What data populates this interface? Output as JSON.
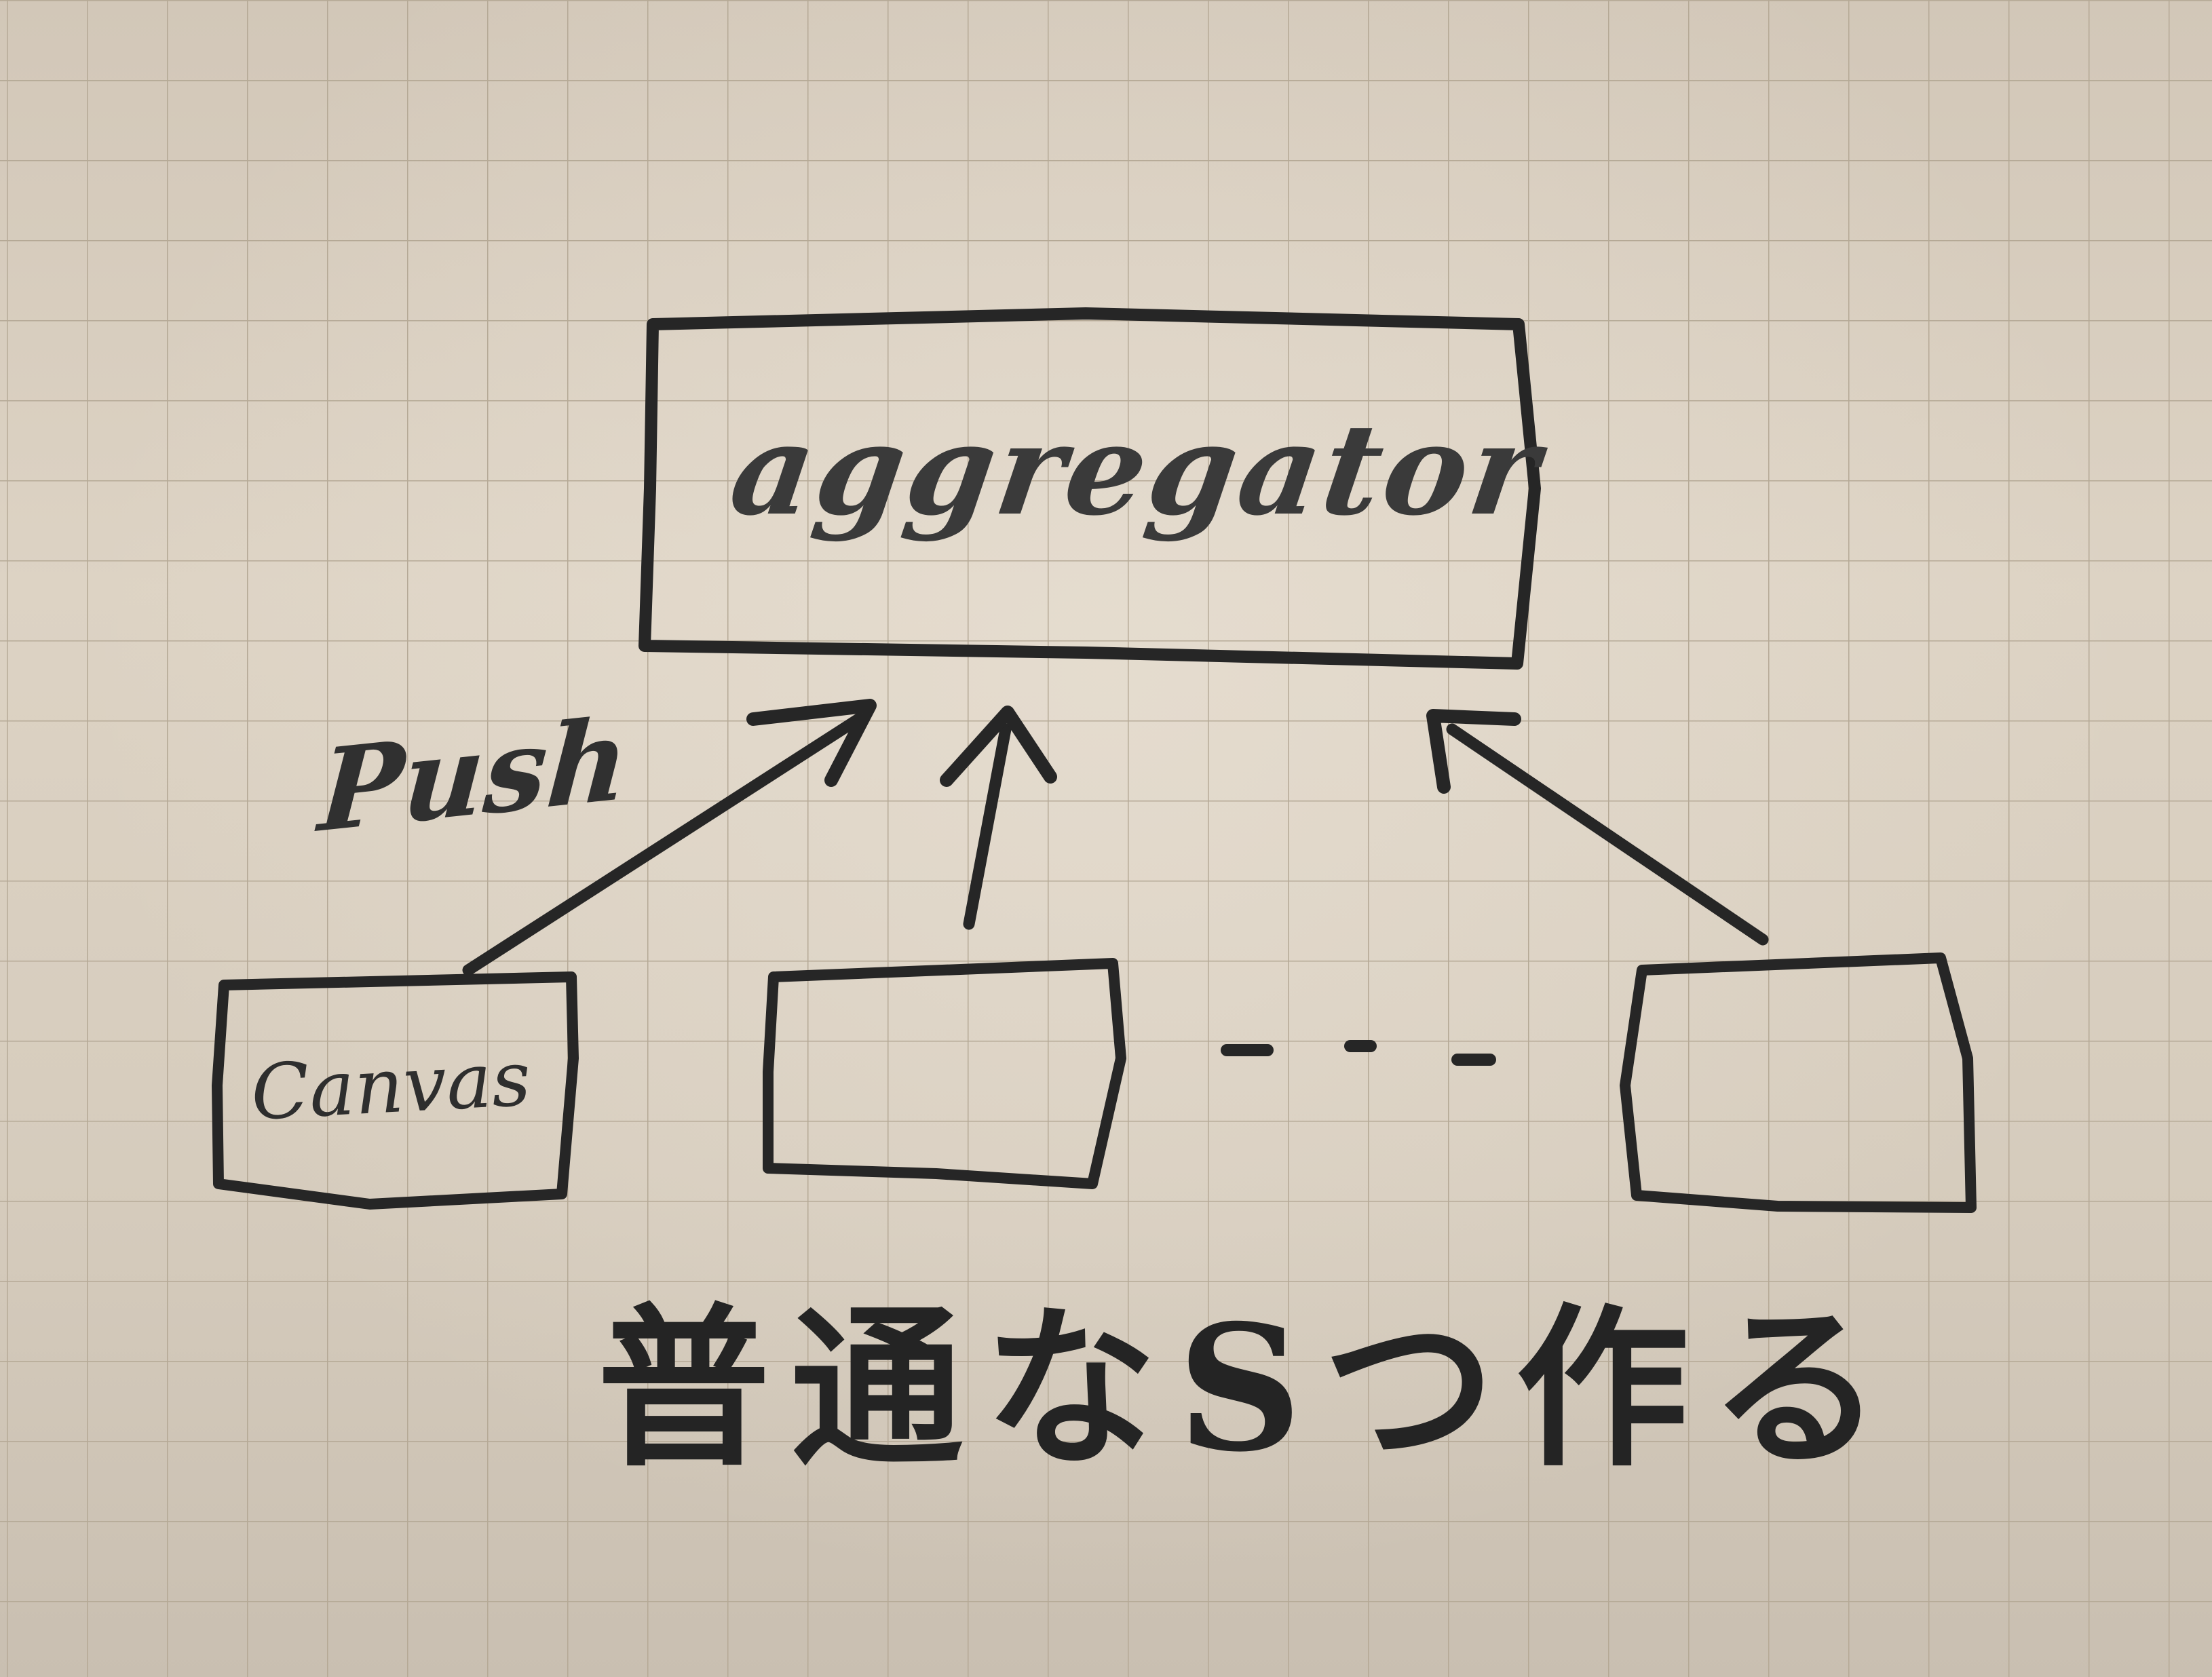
{
  "diagram": {
    "aggregator_label": "aggregator",
    "edge_label": "Push",
    "source_label": "Canvas",
    "ellipsis": "- - -",
    "caption": "普通なSつ作る"
  },
  "colors": {
    "paper": "#d9cfbf",
    "grid_line": "#b9ad9c",
    "pencil": "#262626"
  }
}
